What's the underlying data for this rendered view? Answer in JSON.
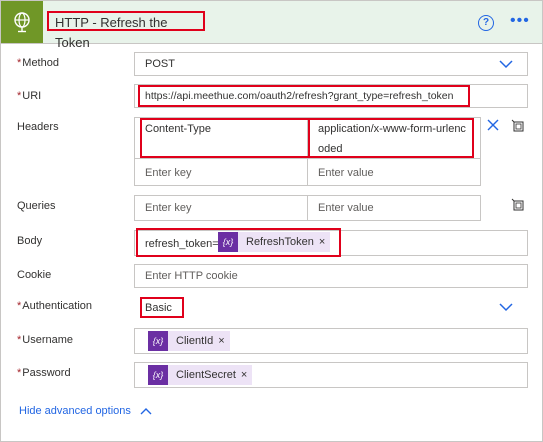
{
  "action": {
    "title": "HTTP - Refresh the Token",
    "help_icon": "?",
    "more_icon": "more-options"
  },
  "required_mark": "*",
  "method": {
    "label": "Method",
    "value": "POST"
  },
  "uri": {
    "label": "URI",
    "value": "https://api.meethue.com/oauth2/refresh?grant_type=refresh_token"
  },
  "headers": {
    "label": "Headers",
    "key": "Content-Type",
    "value_line1": "application/x-www-form-urlenc",
    "value_line2": "oded",
    "key_placeholder": "Enter key",
    "value_placeholder": "Enter value"
  },
  "queries": {
    "label": "Queries",
    "key_placeholder": "Enter key",
    "value_placeholder": "Enter value"
  },
  "body": {
    "label": "Body",
    "prefix": "refresh_token=",
    "token": "RefreshToken"
  },
  "cookie": {
    "label": "Cookie",
    "placeholder": "Enter HTTP cookie"
  },
  "authentication": {
    "label": "Authentication",
    "value": "Basic"
  },
  "username": {
    "label": "Username",
    "token": "ClientId"
  },
  "password": {
    "label": "Password",
    "token": "ClientSecret"
  },
  "token_icon": "{x}",
  "remove_glyph": "×",
  "hide_advanced": "Hide advanced options",
  "colors": {
    "accent": "#2266e3",
    "highlight": "#e0001b",
    "header_bg": "#e8f3ea",
    "header_icon_bg": "#709727",
    "token_bg": "#ede3f6",
    "token_icon_bg": "#6b2fa3"
  }
}
